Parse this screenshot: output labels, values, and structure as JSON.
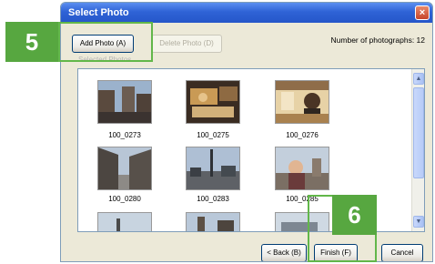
{
  "window": {
    "title": "Select Photo",
    "close_glyph": "×"
  },
  "toolbar": {
    "add_photo_label": "Add Photo (A)",
    "delete_photo_label": "Delete Photo (D)",
    "count_label": "Number of photographs: 12"
  },
  "panel": {
    "section_label": "Selected Photos"
  },
  "photos": [
    {
      "name": "100_0273"
    },
    {
      "name": "100_0275"
    },
    {
      "name": "100_0276"
    },
    {
      "name": "100_0280"
    },
    {
      "name": "100_0283"
    },
    {
      "name": "100_0285"
    }
  ],
  "footer": {
    "back_label": "< Back (B)",
    "finish_label": "Finish (F)",
    "cancel_label": "Cancel"
  },
  "callouts": [
    {
      "label": "5"
    },
    {
      "label": "6"
    }
  ],
  "scrollbar": {
    "up_glyph": "▲",
    "down_glyph": "▼"
  },
  "colors": {
    "callout_green": "#57a740",
    "title_blue": "#2f63d6"
  }
}
